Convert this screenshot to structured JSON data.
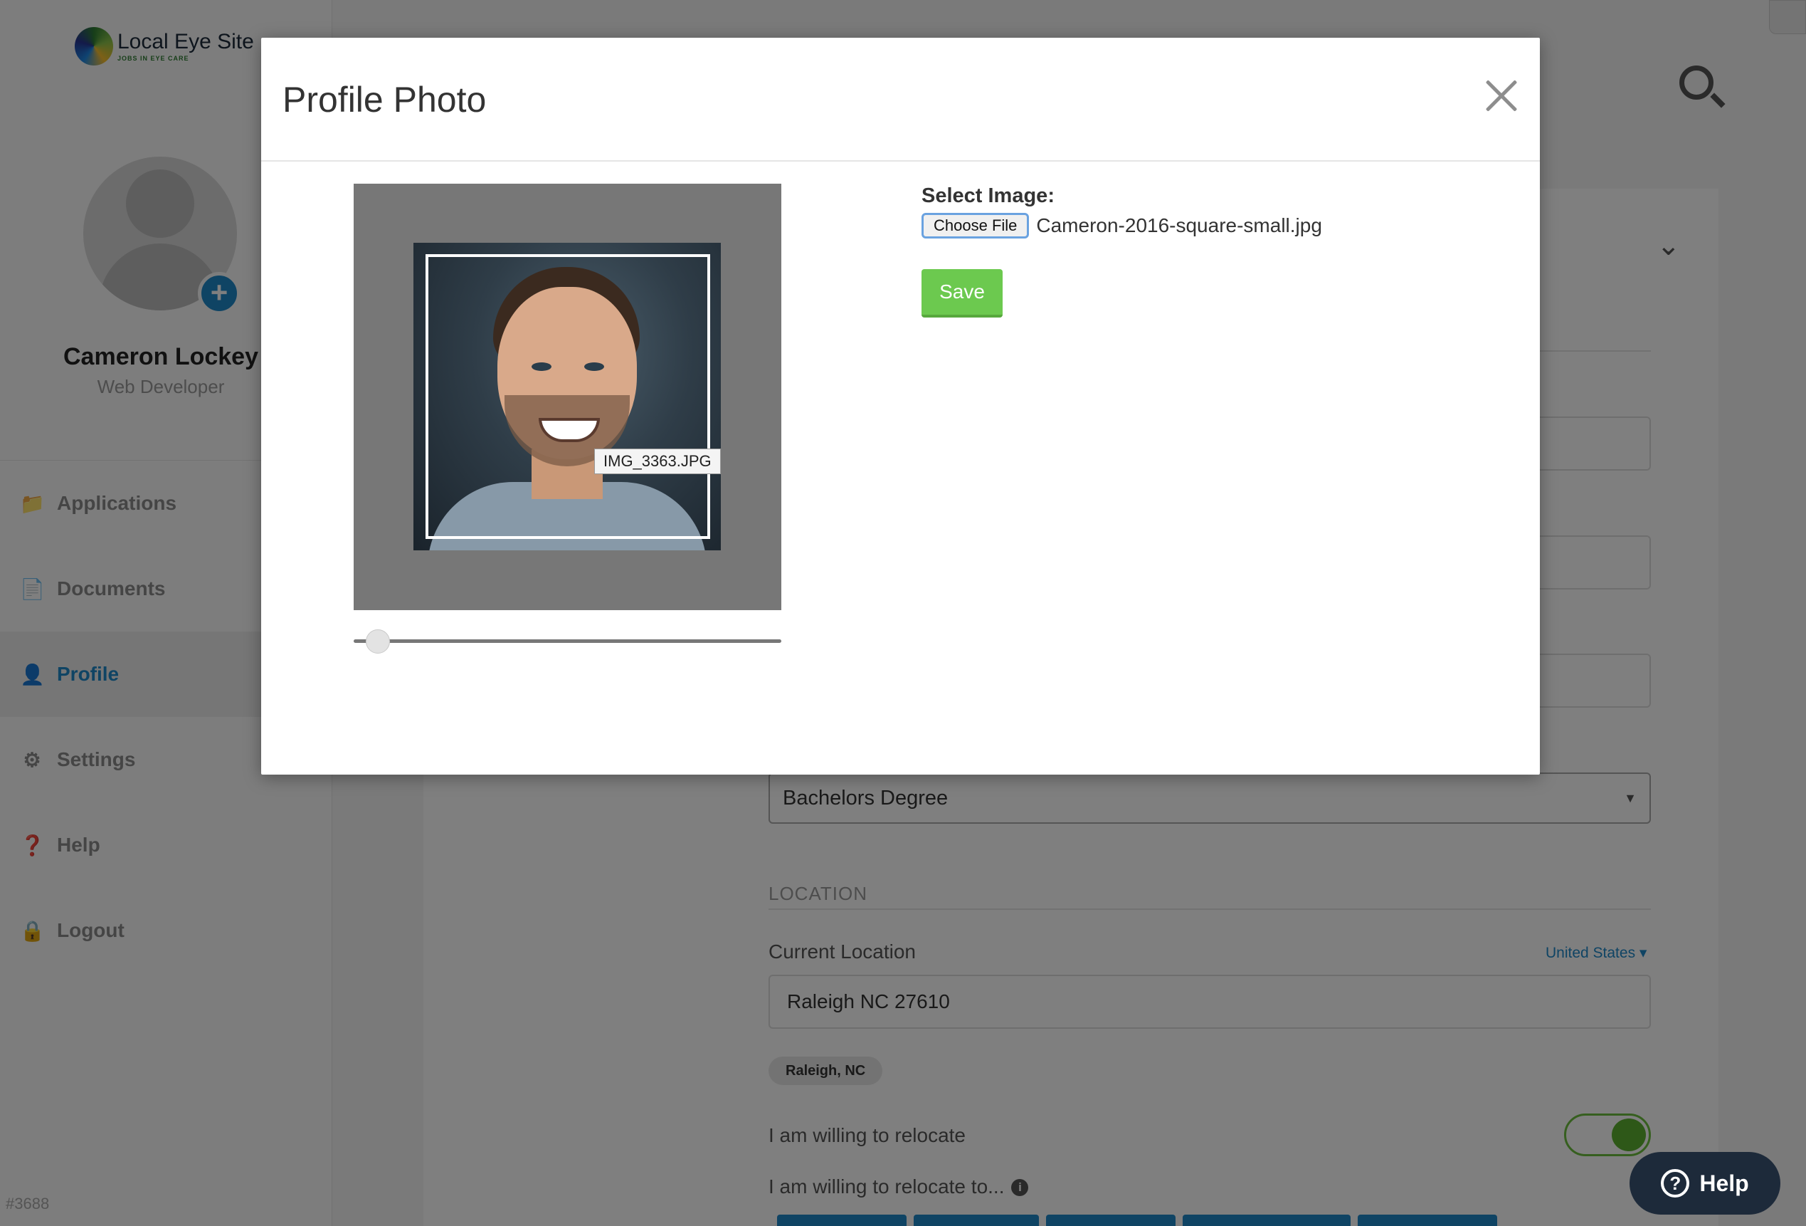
{
  "brand": {
    "name": "Local Eye Site",
    "tagline": "JOBS IN EYE CARE"
  },
  "user": {
    "name": "Cameron Lockey",
    "role": "Web Developer"
  },
  "nav": {
    "items": [
      {
        "label": "Applications",
        "icon": "folder-icon"
      },
      {
        "label": "Documents",
        "icon": "document-icon"
      },
      {
        "label": "Profile",
        "icon": "user-icon",
        "active": true
      },
      {
        "label": "Settings",
        "icon": "gear-icon"
      },
      {
        "label": "Help",
        "icon": "question-icon"
      },
      {
        "label": "Logout",
        "icon": "lock-icon"
      }
    ]
  },
  "build_id": "#3688",
  "form": {
    "education_value": "Bachelors Degree",
    "location_section": "LOCATION",
    "current_location_label": "Current Location",
    "country": "United States",
    "current_location_value": "Raleigh NC 27610",
    "location_tag": "Raleigh, NC",
    "relocate_label": "I am willing to relocate",
    "relocate_on": true,
    "relocate_to_label": "I am willing to relocate to..."
  },
  "help_button": {
    "label": "Help"
  },
  "modal": {
    "title": "Profile Photo",
    "select_label": "Select Image:",
    "choose_file_label": "Choose File",
    "file_name": "Cameron-2016-square-small.jpg",
    "image_tooltip": "IMG_3363.JPG",
    "zoom_level": 0.03,
    "save_label": "Save"
  },
  "colors": {
    "accent": "#1e88c9",
    "save": "#6cc94f",
    "toggle": "#5cb130",
    "overlay": "rgba(0,0,0,0.5)"
  }
}
